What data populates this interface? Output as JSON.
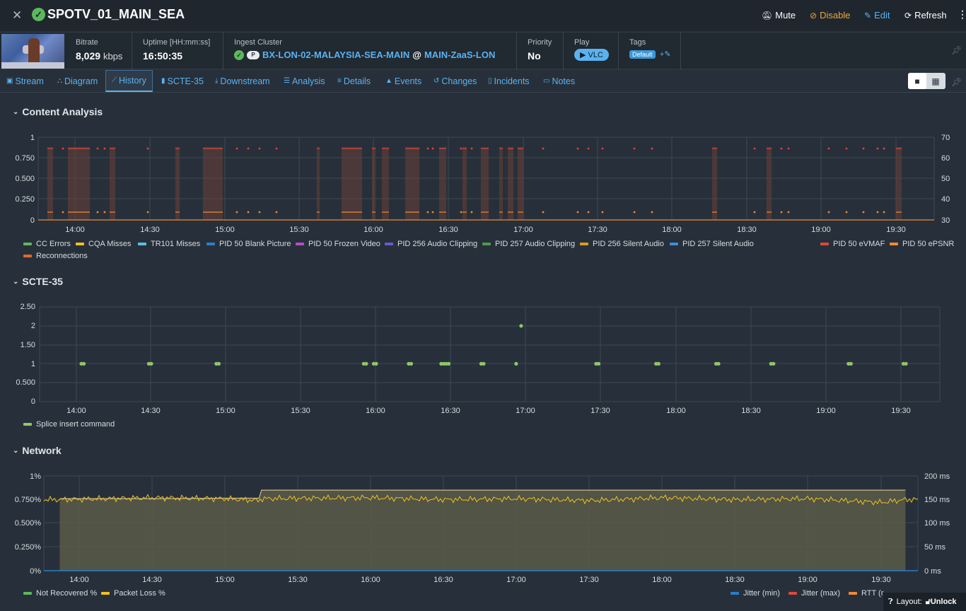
{
  "header": {
    "title": "SPOTV_01_MAIN_SEA",
    "actions": {
      "mute": "Mute",
      "disable": "Disable",
      "edit": "Edit",
      "refresh": "Refresh"
    }
  },
  "info": {
    "bitrate_label": "Bitrate",
    "bitrate_value": "8,029",
    "bitrate_unit": "kbps",
    "uptime_label": "Uptime [HH:mm:ss]",
    "uptime_value": "16:50:35",
    "cluster_label": "Ingest Cluster",
    "cluster_name": "BX-LON-02-MALAYSIA-SEA-MAIN",
    "cluster_at": "@",
    "cluster_zone": "MAIN-ZaaS-LON",
    "cloud_badge": "P",
    "priority_label": "Priority",
    "priority_value": "No",
    "play_label": "Play",
    "play_button": "VLC",
    "tags_label": "Tags",
    "tag_default": "Default",
    "tag_add": "+"
  },
  "tabs": [
    "Stream",
    "Diagram",
    "History",
    "SCTE-35",
    "Downstream",
    "Analysis",
    "Details",
    "Events",
    "Changes",
    "Incidents",
    "Notes"
  ],
  "active_tab": "History",
  "sections": {
    "content": {
      "title": "Content Analysis",
      "yticks_left": [
        "1",
        "0.750",
        "0.500",
        "0.250",
        "0"
      ],
      "yticks_right": [
        "70",
        "60",
        "50",
        "40",
        "30"
      ],
      "xticks": [
        "14:00",
        "14:30",
        "15:00",
        "15:30",
        "16:00",
        "16:30",
        "17:00",
        "17:30",
        "18:00",
        "18:30",
        "19:00",
        "19:30"
      ],
      "legend": [
        "CC Errors",
        "CQA Misses",
        "TR101 Misses",
        "PID 50 Blank Picture",
        "PID 50 Frozen Video",
        "PID 256 Audio Clipping",
        "PID 257 Audio Clipping",
        "PID 256 Silent Audio",
        "PID 257 Silent Audio",
        "PID 50 eVMAF",
        "PID 50 ePSNR",
        "Reconnections"
      ]
    },
    "scte": {
      "title": "SCTE-35",
      "yticks": [
        "2.50",
        "2",
        "1.50",
        "1",
        "0.500",
        "0"
      ],
      "xticks": [
        "14:00",
        "14:30",
        "15:00",
        "15:30",
        "16:00",
        "16:30",
        "17:00",
        "17:30",
        "18:00",
        "18:30",
        "19:00",
        "19:30"
      ],
      "legend": [
        "Splice insert command"
      ]
    },
    "network": {
      "title": "Network",
      "yticks_left": [
        "1%",
        "0.750%",
        "0.500%",
        "0.250%",
        "0%"
      ],
      "yticks_right": [
        "200 ms",
        "150 ms",
        "100 ms",
        "50 ms",
        "0 ms"
      ],
      "xticks": [
        "14:00",
        "14:30",
        "15:00",
        "15:30",
        "16:00",
        "16:30",
        "17:00",
        "17:30",
        "18:00",
        "18:30",
        "19:00",
        "19:30"
      ],
      "legend_left": [
        "Not Recovered %",
        "Packet Loss %"
      ],
      "legend_right": [
        "Jitter (min)",
        "Jitter (max)",
        "RTT (r"
      ]
    }
  },
  "colors": {
    "cc": "#5cb85c",
    "cqa": "#f0c020",
    "tr101": "#5bc0de",
    "blank": "#2a7ec9",
    "frozen": "#b24fc9",
    "clip256": "#6a5acd",
    "clip257": "#4e9a4e",
    "silent256": "#d4a017",
    "silent257": "#3a8fd9",
    "evmaf": "#e0473c",
    "epsnr": "#f08a30",
    "reconn": "#e06a2a",
    "scte": "#8fc76a",
    "jmin": "#2a7ec9",
    "jmax": "#e0473c",
    "rtt": "#f08a30",
    "accent": "#5ab2f0"
  },
  "chart_data": [
    {
      "type": "scatter",
      "title": "SCTE-35",
      "x": [
        "14:02",
        "14:03",
        "14:29",
        "14:30",
        "14:56",
        "14:57",
        "15:55",
        "15:56",
        "15:59",
        "16:00",
        "16:13",
        "16:14",
        "16:26",
        "16:27",
        "16:28",
        "16:29",
        "16:42",
        "16:43",
        "16:56",
        "16:58",
        "17:28",
        "17:29",
        "17:52",
        "17:53",
        "18:16",
        "18:17",
        "18:38",
        "18:39",
        "19:09",
        "19:10",
        "19:31",
        "19:32"
      ],
      "y": [
        1,
        1,
        1,
        1,
        1,
        1,
        1,
        1,
        1,
        1,
        1,
        1,
        1,
        1,
        1,
        1,
        1,
        1,
        1,
        2,
        1,
        1,
        1,
        1,
        1,
        1,
        1,
        1,
        1,
        1,
        1,
        1
      ],
      "series": [
        {
          "name": "Splice insert command"
        }
      ],
      "ylim": [
        0,
        2.5
      ]
    },
    {
      "type": "area",
      "title": "Network",
      "x": [
        "13:52",
        "14:30",
        "15:00",
        "15:14",
        "15:15",
        "16:00",
        "16:30",
        "17:00",
        "17:30",
        "18:00",
        "18:30",
        "19:00",
        "19:30",
        "19:40"
      ],
      "series": [
        {
          "name": "RTT (ms)",
          "values": [
            152,
            152,
            153,
            153,
            170,
            170,
            170,
            170,
            170,
            170,
            170,
            170,
            170,
            170
          ]
        },
        {
          "name": "Packet Loss %",
          "values": [
            0.75,
            0.77,
            0.76,
            0.74,
            0.76,
            0.77,
            0.75,
            0.76,
            0.74,
            0.77,
            0.75,
            0.76,
            0.72,
            0.75
          ]
        }
      ],
      "ylim": [
        0,
        1
      ],
      "ylim_right": [
        0,
        200
      ]
    }
  ]
}
